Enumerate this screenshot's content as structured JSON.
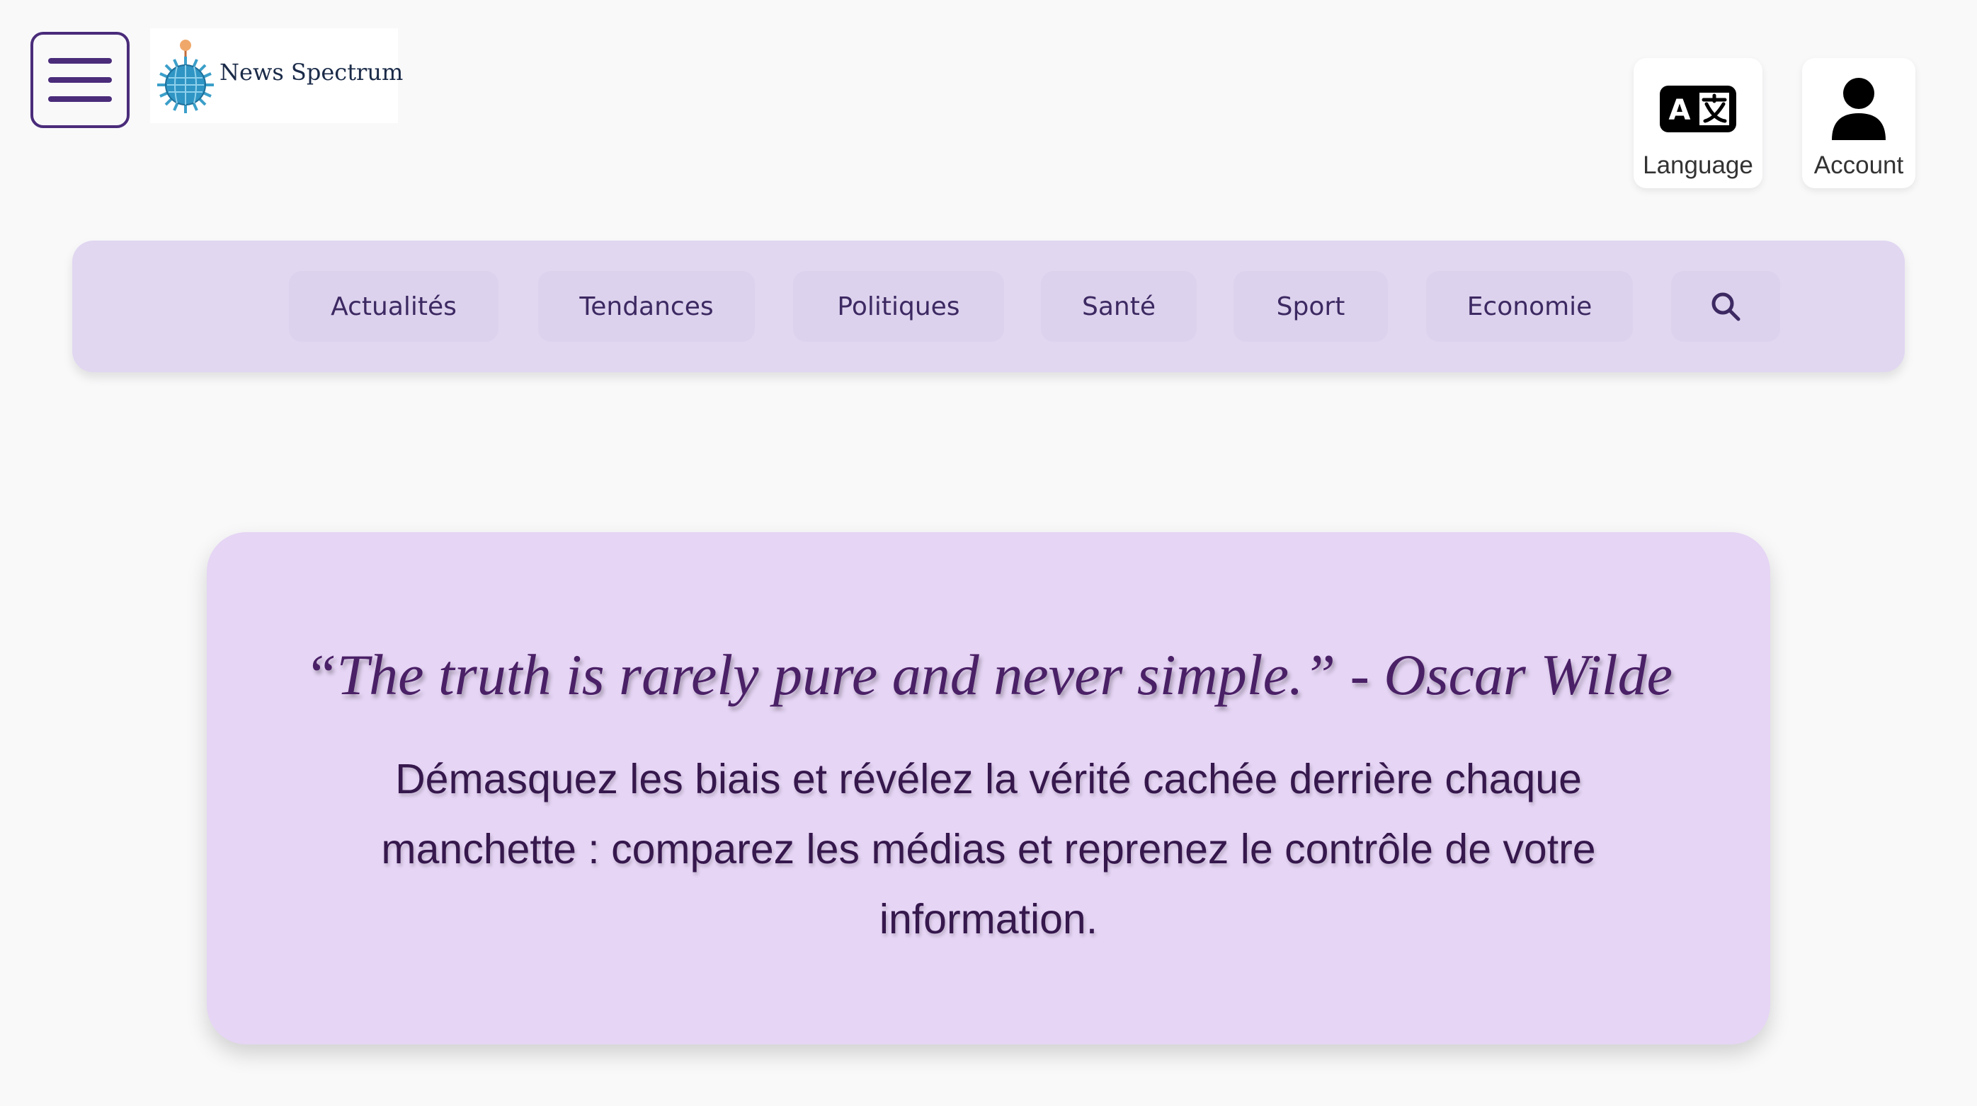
{
  "header": {
    "logo_text": "News Spectrum",
    "language_label": "Language",
    "account_label": "Account"
  },
  "nav": {
    "items": [
      "Actualités",
      "Tendances",
      "Politiques",
      "Santé",
      "Sport",
      "Economie"
    ]
  },
  "hero": {
    "quote": "“The truth is rarely pure and never simple.” - Oscar Wilde",
    "tagline": "Démasquez les biais et révélez la vérité cachée derrière chaque manchette : comparez les médias et reprenez le contrôle de votre information."
  },
  "icons": {
    "menu": "hamburger-icon",
    "language": "translate-icon",
    "account": "user-icon",
    "search": "search-icon"
  },
  "colors": {
    "accent": "#4a2c7a",
    "nav_bg": "#e1d7f1",
    "hero_bg": "#e6d5f5",
    "quote_text": "#4a2066"
  }
}
